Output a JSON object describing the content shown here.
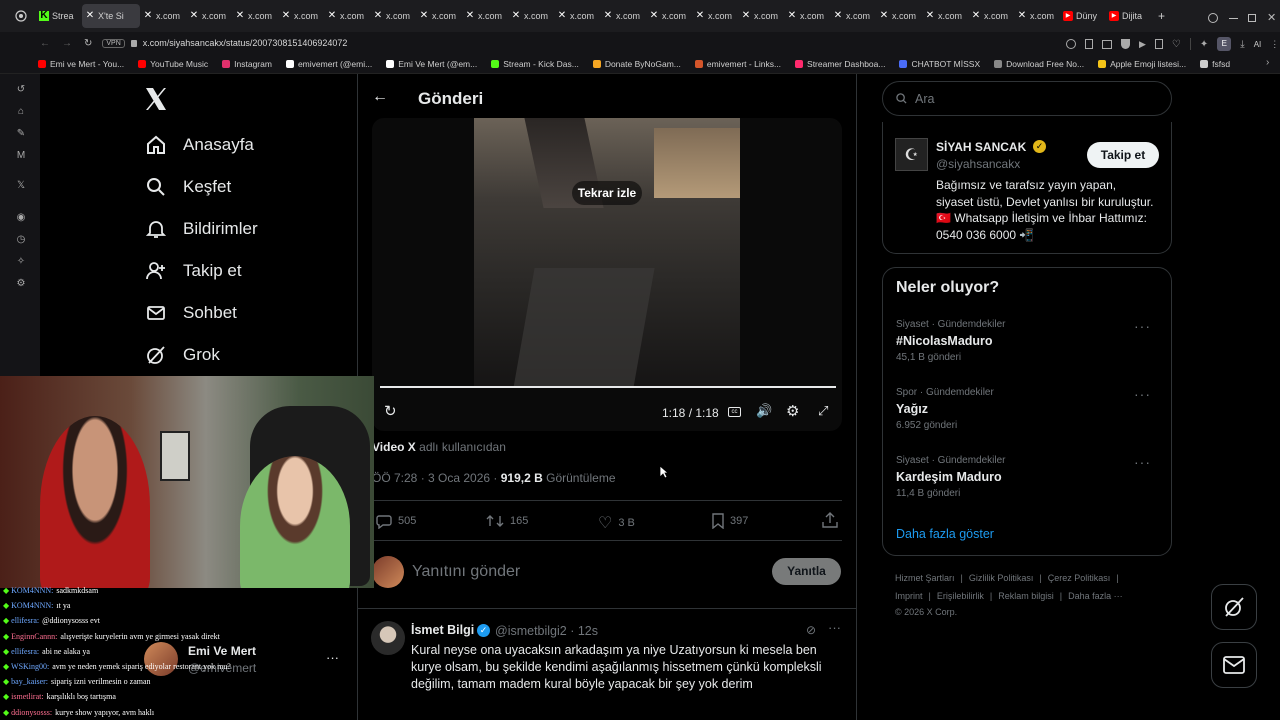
{
  "browser": {
    "tabs": [
      {
        "label": "Strea",
        "active": false,
        "icon": "kick-icon"
      },
      {
        "label": "X'te Si",
        "active": true,
        "icon": "x-icon"
      },
      {
        "label": "x.com",
        "active": false,
        "icon": "x-icon"
      },
      {
        "label": "x.com",
        "active": false,
        "icon": "x-icon"
      },
      {
        "label": "x.com",
        "active": false,
        "icon": "x-icon"
      },
      {
        "label": "x.com",
        "active": false,
        "icon": "x-icon"
      },
      {
        "label": "x.com",
        "active": false,
        "icon": "x-icon"
      },
      {
        "label": "x.com",
        "active": false,
        "icon": "x-icon"
      },
      {
        "label": "x.com",
        "active": false,
        "icon": "x-icon"
      },
      {
        "label": "x.com",
        "active": false,
        "icon": "x-icon"
      },
      {
        "label": "x.com",
        "active": false,
        "icon": "x-icon"
      },
      {
        "label": "x.com",
        "active": false,
        "icon": "x-icon"
      },
      {
        "label": "x.com",
        "active": false,
        "icon": "x-icon"
      },
      {
        "label": "x.com",
        "active": false,
        "icon": "x-icon"
      },
      {
        "label": "x.com",
        "active": false,
        "icon": "x-icon"
      },
      {
        "label": "x.com",
        "active": false,
        "icon": "x-icon"
      },
      {
        "label": "x.com",
        "active": false,
        "icon": "x-icon"
      },
      {
        "label": "x.com",
        "active": false,
        "icon": "x-icon"
      },
      {
        "label": "x.com",
        "active": false,
        "icon": "x-icon"
      },
      {
        "label": "x.com",
        "active": false,
        "icon": "x-icon"
      },
      {
        "label": "x.com",
        "active": false,
        "icon": "x-icon"
      },
      {
        "label": "x.com",
        "active": false,
        "icon": "x-icon"
      },
      {
        "label": "Düny",
        "active": false,
        "icon": "youtube-icon"
      },
      {
        "label": "Dijita",
        "active": false,
        "icon": "youtube-icon"
      }
    ],
    "new_tab": "+",
    "vpn_label": "VPN",
    "url": "x.com/siyahsancakx/status/2007308151406924072",
    "ext_letter": "E",
    "ai_label": "AI",
    "bookmarks": [
      {
        "label": "Emi ve Mert - You...",
        "color": "#ff0000"
      },
      {
        "label": "YouTube Music",
        "color": "#ff0000"
      },
      {
        "label": "Instagram",
        "color": "#e1306c"
      },
      {
        "label": "emivemert (@emi...",
        "color": "#ffffff"
      },
      {
        "label": "Emi Ve Mert (@em...",
        "color": "#ffffff"
      },
      {
        "label": "Stream - Kick Das...",
        "color": "#53fc18"
      },
      {
        "label": "Donate ByNoGam...",
        "color": "#f5a623"
      },
      {
        "label": "emivemert - Links...",
        "color": "#d4552a"
      },
      {
        "label": "Streamer Dashboa...",
        "color": "#ff2a6d"
      },
      {
        "label": "CHATBOT MİSSX",
        "color": "#4a6cf7"
      },
      {
        "label": "Download Free No...",
        "color": "#888888"
      },
      {
        "label": "Apple Emoji listesi...",
        "color": "#f5c518"
      },
      {
        "label": "fsfsd",
        "color": "#cccccc"
      }
    ]
  },
  "nav": {
    "items": [
      {
        "label": "Anasayfa",
        "icon": "home-icon"
      },
      {
        "label": "Keşfet",
        "icon": "search-icon"
      },
      {
        "label": "Bildirimler",
        "icon": "bell-icon"
      },
      {
        "label": "Takip et",
        "icon": "follow-icon"
      },
      {
        "label": "Sohbet",
        "icon": "mail-icon"
      },
      {
        "label": "Grok",
        "icon": "grok-icon"
      }
    ]
  },
  "post_page": {
    "header": "Gönderi",
    "video": {
      "replay_label": "Tekrar izle",
      "time": "1:18 / 1:18",
      "progress": 1.0
    },
    "video_attribution_bold": "Video X",
    "video_attribution_rest": "adlı kullanıcıdan",
    "meta_time": "ÖÖ 7:28 · 3 Oca 2026 ·",
    "views_count": "919,2 B",
    "views_label": "Görüntüleme",
    "actions": {
      "replies": "505",
      "reposts": "165",
      "likes": "3 B",
      "bookmarks": "397"
    },
    "reply_placeholder": "Yanıtını gönder",
    "reply_button": "Yanıtla",
    "reply": {
      "name": "İsmet Bilgi",
      "handle": "@ismetbilgi2 · 12s",
      "text": "Kural neyse ona uyacaksın arkadaşım ya niye Uzatıyorsun ki mesela ben kurye olsam, bu şekilde kendimi aşağılanmış hissetmem çünkü kompleksli değilim,  tamam madem kural böyle yapacak bir şey yok derim"
    }
  },
  "search": {
    "placeholder": "Ara"
  },
  "profile_card": {
    "name": "SİYAH SANCAK",
    "handle": "@siyahsancakx",
    "follow_button": "Takip et",
    "bio": "Bağımsız ve tarafsız yayın yapan, siyaset üstü, Devlet yanlısı bir kuruluştur. 🇹🇷 Whatsapp İletişim ve İhbar Hattımız: 0540 036 6000 📲"
  },
  "trends": {
    "title": "Neler oluyor?",
    "items": [
      {
        "category": "Siyaset · Gündemdekiler",
        "name": "#NicolasMaduro",
        "count": "45,1 B gönderi"
      },
      {
        "category": "Spor · Gündemdekiler",
        "name": "Yağız",
        "count": "6.952 gönderi"
      },
      {
        "category": "Siyaset · Gündemdekiler",
        "name": "Kardeşim Maduro",
        "count": "11,4 B gönderi"
      }
    ],
    "show_more": "Daha fazla göster"
  },
  "footer": {
    "links_row1": [
      "Hizmet Şartları",
      "Gizlilik Politikası",
      "Çerez Politikası"
    ],
    "links_row2": [
      "Imprint",
      "Erişilebilirlik",
      "Reklam bilgisi",
      "Daha fazla ···"
    ],
    "copyright": "© 2026 X Corp."
  },
  "account_preview": {
    "name": "Emi Ve Mert",
    "handle": "@emivemert",
    "more": "···"
  },
  "chat": [
    {
      "user": "KOM4NNN:",
      "text": "sadkmkdsam"
    },
    {
      "user": "KOM4NNN:",
      "text": "ıt ya"
    },
    {
      "user": "ellifesra:",
      "text": "@ddionysosss evt"
    },
    {
      "user": "EnginnCannn:",
      "text": "alışverişte kuryelerin avm ye girmesi yasak direkt"
    },
    {
      "user": "ellifesra:",
      "text": "abi ne alaka ya"
    },
    {
      "user": "WSKing00:",
      "text": "avm ye neden yemek sipariş ediyolar restorant yok mu?"
    },
    {
      "user": "bay_kaiser:",
      "text": "sipariş izni verilmesin o zaman"
    },
    {
      "user": "ismetlirat:",
      "text": "karşılıklı boş tartışma"
    },
    {
      "user": "ddionysosss:",
      "text": "kurye show yapıyor, avm haklı"
    }
  ],
  "colors": {
    "accent": "#1d9bf0",
    "verified_gold": "#e2b719",
    "verified_blue": "#1d9bf0",
    "text": "#e7e9ea",
    "muted": "#71767b",
    "border": "#2f3336"
  }
}
